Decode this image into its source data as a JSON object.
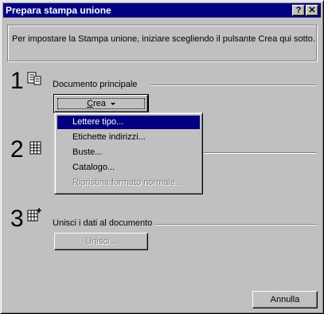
{
  "window": {
    "title": "Prepara stampa unione",
    "help_label": "?",
    "close_label": "✕"
  },
  "instructions": "Per impostare la Stampa unione, iniziare scegliendo il pulsante Crea qui sotto.",
  "steps": [
    {
      "number": "1",
      "label": "Documento principale",
      "icon": "document-icon"
    },
    {
      "number": "2",
      "label": "",
      "icon": "data-source-icon"
    },
    {
      "number": "3",
      "label": "Unisci i dati al documento",
      "icon": "merge-icon"
    }
  ],
  "buttons": {
    "crea_first": "C",
    "crea_rest": "rea",
    "unisci": "Unisci...",
    "annulla": "Annulla"
  },
  "menu": {
    "items": [
      {
        "label": "Lettere tipo...",
        "selected": true,
        "enabled": true
      },
      {
        "label": "Etichette indirizzi...",
        "selected": false,
        "enabled": true
      },
      {
        "label": "Buste...",
        "selected": false,
        "enabled": true
      },
      {
        "label": "Catalogo...",
        "selected": false,
        "enabled": true
      },
      {
        "label": "Ripristina formato normale...",
        "selected": false,
        "enabled": false
      }
    ]
  },
  "colors": {
    "titlebar": "#000080",
    "face": "#c0c0c0",
    "highlight": "#000080",
    "disabled_text": "#808080"
  }
}
